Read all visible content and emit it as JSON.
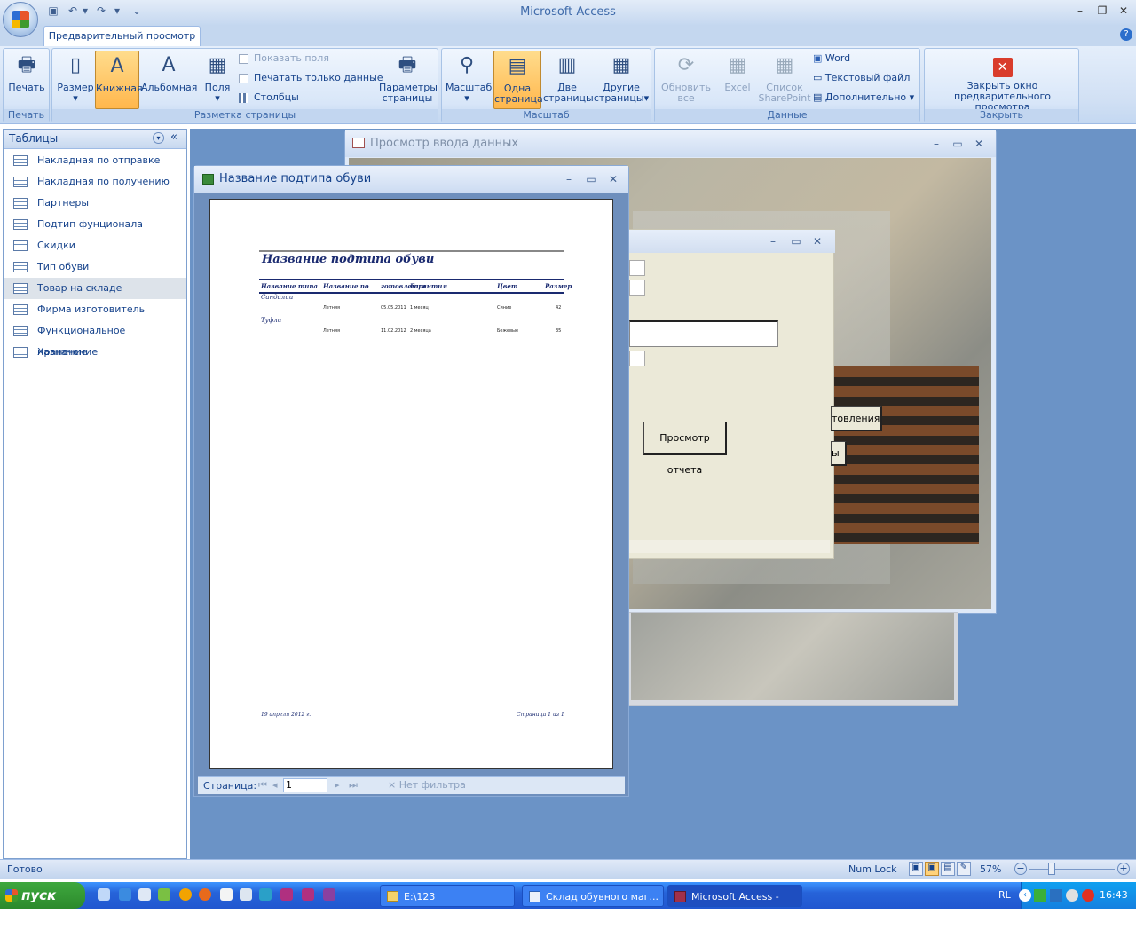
{
  "app": {
    "title": "Microsoft Access",
    "tab": "Предварительный просмотр"
  },
  "ribbon": {
    "print": {
      "btn": "Печать",
      "group": "Печать"
    },
    "layout": {
      "size": "Размер",
      "portrait": "Книжная",
      "landscape": "Альбомная",
      "margins": "Поля",
      "show_fields": "Показать поля",
      "print_data_only": "Печатать только данные",
      "columns": "Столбцы",
      "page_setup": [
        "Параметры",
        "страницы"
      ],
      "group": "Разметка страницы"
    },
    "zoom": {
      "zoom": "Масштаб",
      "one_page": [
        "Одна",
        "страница"
      ],
      "two_pages": [
        "Две",
        "страницы"
      ],
      "more_pages": [
        "Другие",
        "страницы"
      ],
      "group": "Масштаб"
    },
    "data": {
      "refresh": [
        "Обновить",
        "все"
      ],
      "excel": "Excel",
      "sharepoint": [
        "Список",
        "SharePoint"
      ],
      "word": "Word",
      "text_file": "Текстовый файл",
      "more": "Дополнительно",
      "group": "Данные"
    },
    "close": {
      "btn": [
        "Закрыть окно",
        "предварительного просмотра"
      ],
      "group": "Закрыть"
    }
  },
  "nav": {
    "header": "Таблицы",
    "items": [
      "Накладная по отправке",
      "Накладная по получению",
      "Партнеры",
      "Подтип фунционала",
      "Скидки",
      "Тип обуви",
      "Товар на складе",
      "Фирма изготовитель",
      "Функциональное назначение",
      "Хранение"
    ],
    "selected_index": 6
  },
  "form_window": {
    "title": "Просмотр ввода данных",
    "btn_report": "Просмотр отчета",
    "btn_partial_1": "товления",
    "btn_partial_2": "ы"
  },
  "report_window": {
    "title": "Название подтипа обуви",
    "report": {
      "heading": "Название подтипа обуви",
      "columns": [
        "Название типа",
        "Название по",
        "готовления",
        "Гарантия",
        "Цвет",
        "Размер"
      ],
      "groups": [
        {
          "type": "Сандалии",
          "rows": [
            [
              "Летняя",
              "05.05.2011",
              "1 месяц",
              "Синие",
              "42"
            ]
          ]
        },
        {
          "type": "Туфли",
          "rows": [
            [
              "Летняя",
              "11.02.2012",
              "2 месяца",
              "Бежевые",
              "35"
            ]
          ]
        }
      ],
      "footer_date": "19 апреля 2012 г.",
      "footer_page": "Страница 1 из 1"
    },
    "pager": {
      "label": "Страница:",
      "value": "1",
      "filter": "Нет фильтра"
    }
  },
  "status": {
    "left": "Готово",
    "numlock": "Num Lock",
    "zoom": "57%"
  },
  "taskbar": {
    "start": "пуск",
    "tasks": [
      "E:\\123",
      "Склад обувного маг...",
      "Microsoft Access - Ку..."
    ],
    "lang": "RL",
    "time": "16:43"
  }
}
